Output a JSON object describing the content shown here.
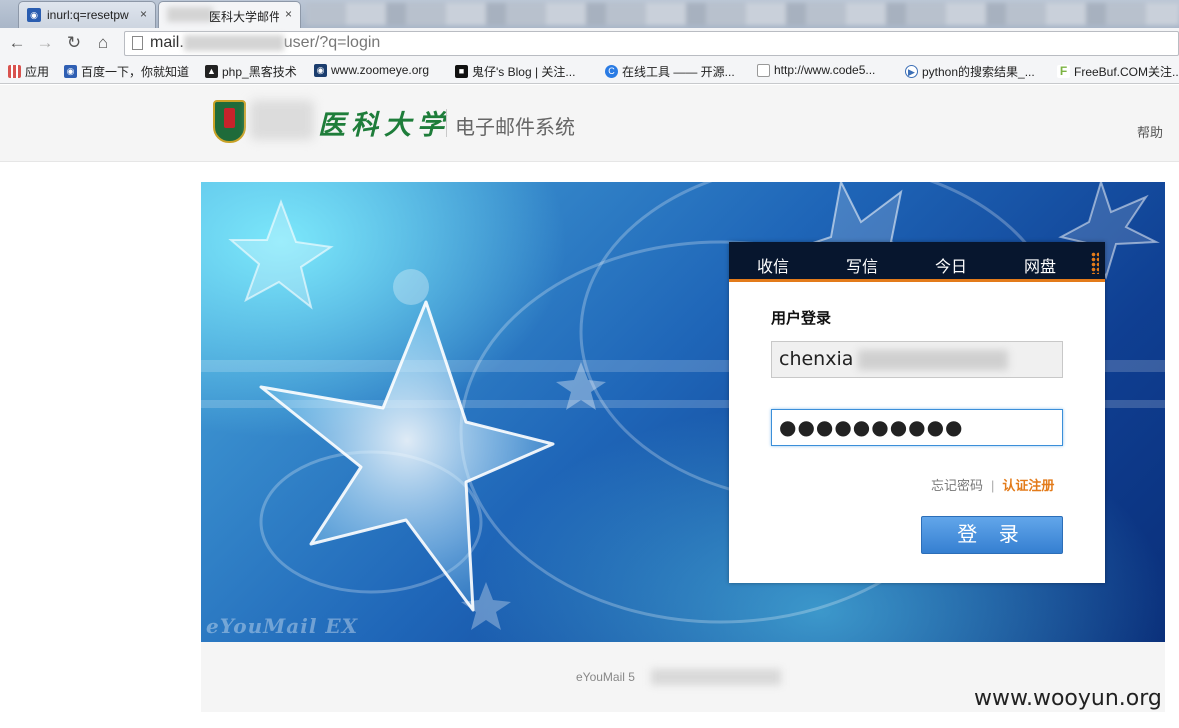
{
  "browser": {
    "tabs": [
      {
        "title": "inurl:q=resetpw",
        "close": "×",
        "active": false
      },
      {
        "title": "医科大学邮件",
        "close": "×",
        "active": true
      }
    ],
    "url_prefix": "mail.",
    "url_suffix": "user/?q=login",
    "bookmarks": [
      {
        "label": "应用",
        "icon": "apps-grid-icon",
        "color": "#d9534f"
      },
      {
        "label": "百度一下，你就知道",
        "icon": "baidu-paw-icon",
        "color": "#2f5fb3"
      },
      {
        "label": "php_黑客技术",
        "icon": "hat-icon",
        "color": "#222222"
      },
      {
        "label": "www.zoomeye.org",
        "icon": "eye-icon",
        "color": "#1b3d6e"
      },
      {
        "label": "鬼仔's Blog | 关注...",
        "icon": "ghost-icon",
        "color": "#111111"
      },
      {
        "label": "在线工具 —— 开源...",
        "icon": "c-logo-icon",
        "color": "#2a7be4"
      },
      {
        "label": "http://www.code5...",
        "icon": "page-icon",
        "color": "#999999"
      },
      {
        "label": "python的搜索结果_...",
        "icon": "play-circle-icon",
        "color": "#3c6fb6"
      },
      {
        "label": "FreeBuf.COM关注...",
        "icon": "freebuf-f-icon",
        "color": "#7cb342"
      }
    ]
  },
  "header": {
    "university_name": "医科大学",
    "system_title": "电子邮件系统",
    "help_label": "帮助"
  },
  "banner": {
    "product_logo": "eYouMail EX"
  },
  "login_panel": {
    "nav": [
      "收信",
      "写信",
      "今日",
      "网盘"
    ],
    "title": "用户登录",
    "username_value": "chenxia",
    "password_mask": "●●●●●●●●●●",
    "forgot_label": "忘记密码",
    "separator": "|",
    "register_label": "认证注册",
    "login_button": "登 录"
  },
  "footer": {
    "version": "eYouMail 5"
  },
  "watermark": "www.wooyun.org",
  "colors": {
    "accent_orange": "#e37b1a",
    "nav_dark": "#07162e",
    "login_blue": "#357fd1",
    "uni_green": "#1e7d3a"
  }
}
